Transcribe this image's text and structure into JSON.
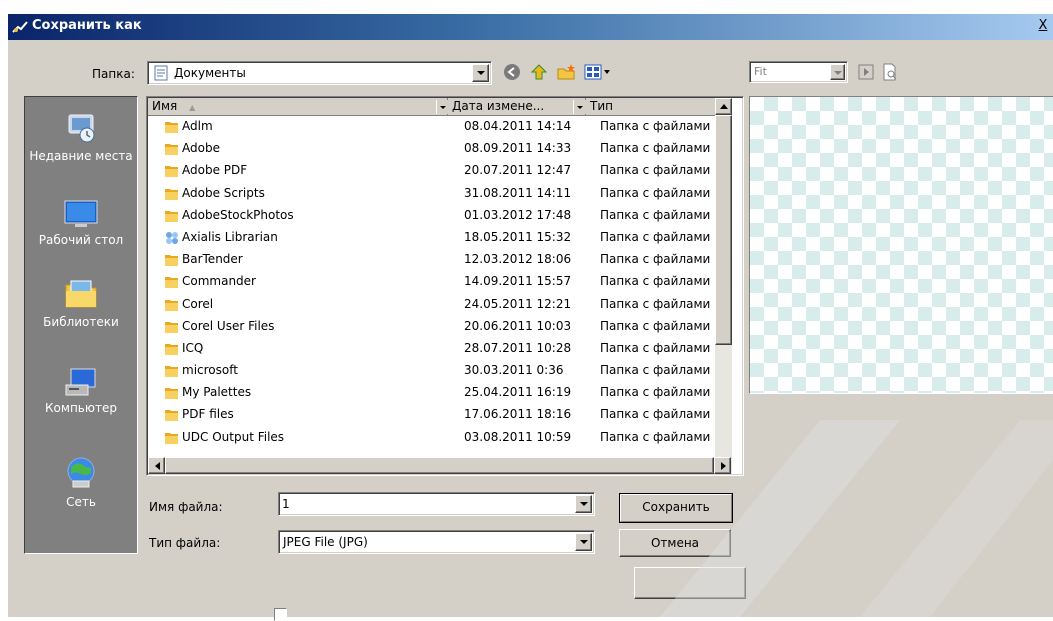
{
  "window": {
    "title": "Сохранить как",
    "close_glyph": "X"
  },
  "lookin": {
    "label": "Папка:",
    "value": "Документы",
    "icon": "documents-folder-icon"
  },
  "toolbar": {
    "icons": [
      "back-icon",
      "up-folder-icon",
      "new-folder-icon",
      "view-menu-icon"
    ]
  },
  "places": [
    {
      "label": "Недавние места",
      "icon": "recent-places-icon"
    },
    {
      "label": "Рабочий стол",
      "icon": "desktop-icon"
    },
    {
      "label": "Библиотеки",
      "icon": "libraries-icon"
    },
    {
      "label": "Компьютер",
      "icon": "computer-icon"
    },
    {
      "label": "Сеть",
      "icon": "network-icon"
    }
  ],
  "list": {
    "columns": {
      "name": "Имя",
      "date": "Дата измене...",
      "type": "Тип"
    },
    "sort_glyph": "▲",
    "rows": [
      {
        "name": "Adlm",
        "date": "08.04.2011 14:14",
        "type": "Папка с файлами",
        "icon": "folder-icon"
      },
      {
        "name": "Adobe",
        "date": "08.09.2011 14:33",
        "type": "Папка с файлами",
        "icon": "folder-icon"
      },
      {
        "name": "Adobe PDF",
        "date": "20.07.2011 12:47",
        "type": "Папка с файлами",
        "icon": "folder-icon"
      },
      {
        "name": "Adobe Scripts",
        "date": "31.08.2011 14:11",
        "type": "Папка с файлами",
        "icon": "folder-icon"
      },
      {
        "name": "AdobeStockPhotos",
        "date": "01.03.2012 17:48",
        "type": "Папка с файлами",
        "icon": "folder-icon"
      },
      {
        "name": "Axialis Librarian",
        "date": "18.05.2011 15:32",
        "type": "Папка с файлами",
        "icon": "special-folder-icon"
      },
      {
        "name": "BarTender",
        "date": "12.03.2012 18:06",
        "type": "Папка с файлами",
        "icon": "folder-icon"
      },
      {
        "name": "Commander",
        "date": "14.09.2011 15:57",
        "type": "Папка с файлами",
        "icon": "folder-icon"
      },
      {
        "name": "Corel",
        "date": "24.05.2011 12:21",
        "type": "Папка с файлами",
        "icon": "folder-icon"
      },
      {
        "name": "Corel User Files",
        "date": "20.06.2011 10:03",
        "type": "Папка с файлами",
        "icon": "folder-icon"
      },
      {
        "name": "ICQ",
        "date": "28.07.2011 10:28",
        "type": "Папка с файлами",
        "icon": "folder-icon"
      },
      {
        "name": "microsoft",
        "date": "30.03.2011 0:36",
        "type": "Папка с файлами",
        "icon": "folder-icon"
      },
      {
        "name": "My Palettes",
        "date": "25.04.2011 16:19",
        "type": "Папка с файлами",
        "icon": "folder-icon"
      },
      {
        "name": "PDF files",
        "date": "17.06.2011 18:16",
        "type": "Папка с файлами",
        "icon": "folder-icon"
      },
      {
        "name": "UDC Output Files",
        "date": "03.08.2011 10:59",
        "type": "Папка с файлами",
        "icon": "folder-icon"
      }
    ]
  },
  "filename": {
    "label": "Имя файла:",
    "value": "1"
  },
  "filetype": {
    "label": "Тип файла:",
    "value": "JPEG File (JPG)"
  },
  "buttons": {
    "save": "Сохранить",
    "cancel": "Отмена",
    "extra": ""
  },
  "preview": {
    "zoom": "Fit"
  },
  "colors": {
    "title_start": "#0a246a",
    "title_end": "#a6caf0",
    "face": "#d4d0c8",
    "places_bg": "#808080",
    "folder": "#f5c542",
    "checker": "#d8eceb"
  }
}
